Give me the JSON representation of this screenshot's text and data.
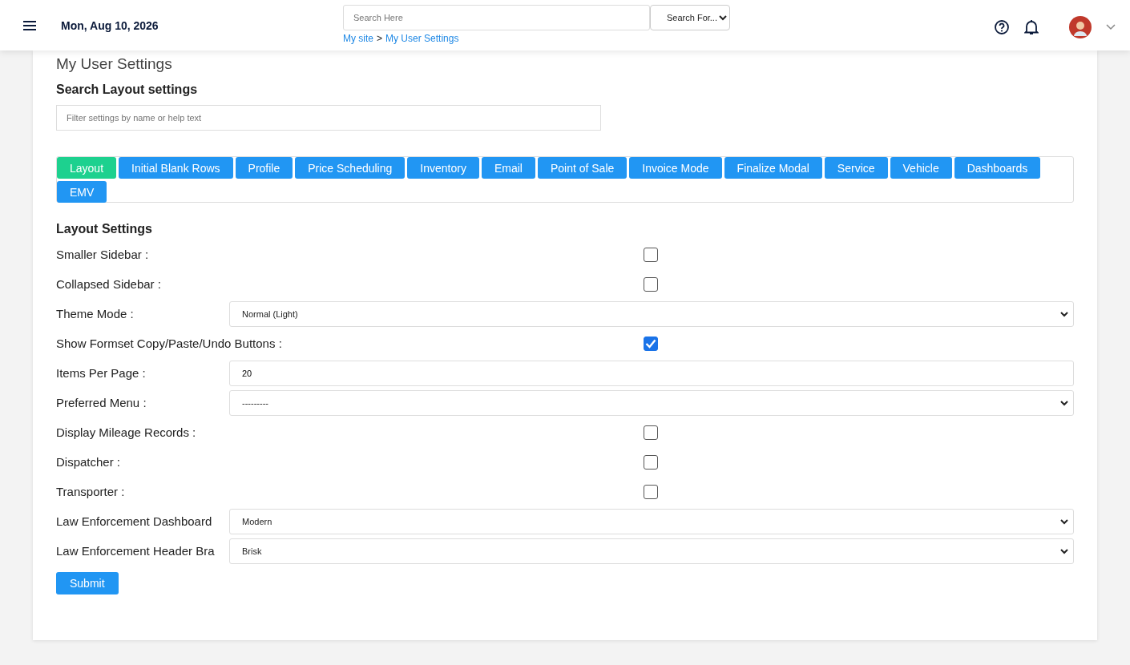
{
  "header": {
    "date": "Mon, Aug 10, 2026",
    "search": {
      "placeholder": "Search Here"
    },
    "search_for": "Search For...",
    "breadcrumb": [
      "My site",
      "My User Settings"
    ],
    "breadcrumb_separator": ">"
  },
  "page_title": "My User Settings",
  "filter": {
    "heading": "Search Layout settings",
    "placeholder": "Filter settings by name or help text"
  },
  "tabs": [
    {
      "label": "Layout",
      "selected": true
    },
    {
      "label": "Initial Blank Rows",
      "selected": false
    },
    {
      "label": "Profile",
      "selected": false
    },
    {
      "label": "Price Scheduling",
      "selected": false
    },
    {
      "label": "Inventory",
      "selected": false
    },
    {
      "label": "Email",
      "selected": false
    },
    {
      "label": "Point of Sale",
      "selected": false
    },
    {
      "label": "Invoice Mode",
      "selected": false
    },
    {
      "label": "Finalize Modal",
      "selected": false
    },
    {
      "label": "Service",
      "selected": false
    },
    {
      "label": "Vehicle",
      "selected": false
    },
    {
      "label": "Dashboards",
      "selected": false
    },
    {
      "label": "EMV",
      "selected": false
    }
  ],
  "section_title": "Layout Settings",
  "settings": [
    {
      "kind": "checkbox",
      "label": "Smaller Sidebar :",
      "checked": false
    },
    {
      "kind": "checkbox",
      "label": "Collapsed Sidebar :",
      "checked": false
    },
    {
      "kind": "select",
      "label": "Theme Mode :",
      "value": "Normal (Light)"
    },
    {
      "kind": "checkbox",
      "label": "Show Formset Copy/Paste/Undo Buttons :",
      "checked": true
    },
    {
      "kind": "text",
      "label": "Items Per Page :",
      "value": "20"
    },
    {
      "kind": "select",
      "label": "Preferred Menu :",
      "value": "---------"
    },
    {
      "kind": "checkbox",
      "label": "Display Mileage Records :",
      "checked": false
    },
    {
      "kind": "checkbox",
      "label": "Dispatcher :",
      "checked": false
    },
    {
      "kind": "checkbox",
      "label": "Transporter :",
      "checked": false
    },
    {
      "kind": "select",
      "label": "Law Enforcement Dashboard",
      "value": "Modern"
    },
    {
      "kind": "select",
      "label": "Law Enforcement Header Bra",
      "value": "Brisk"
    }
  ],
  "submit": "Submit"
}
